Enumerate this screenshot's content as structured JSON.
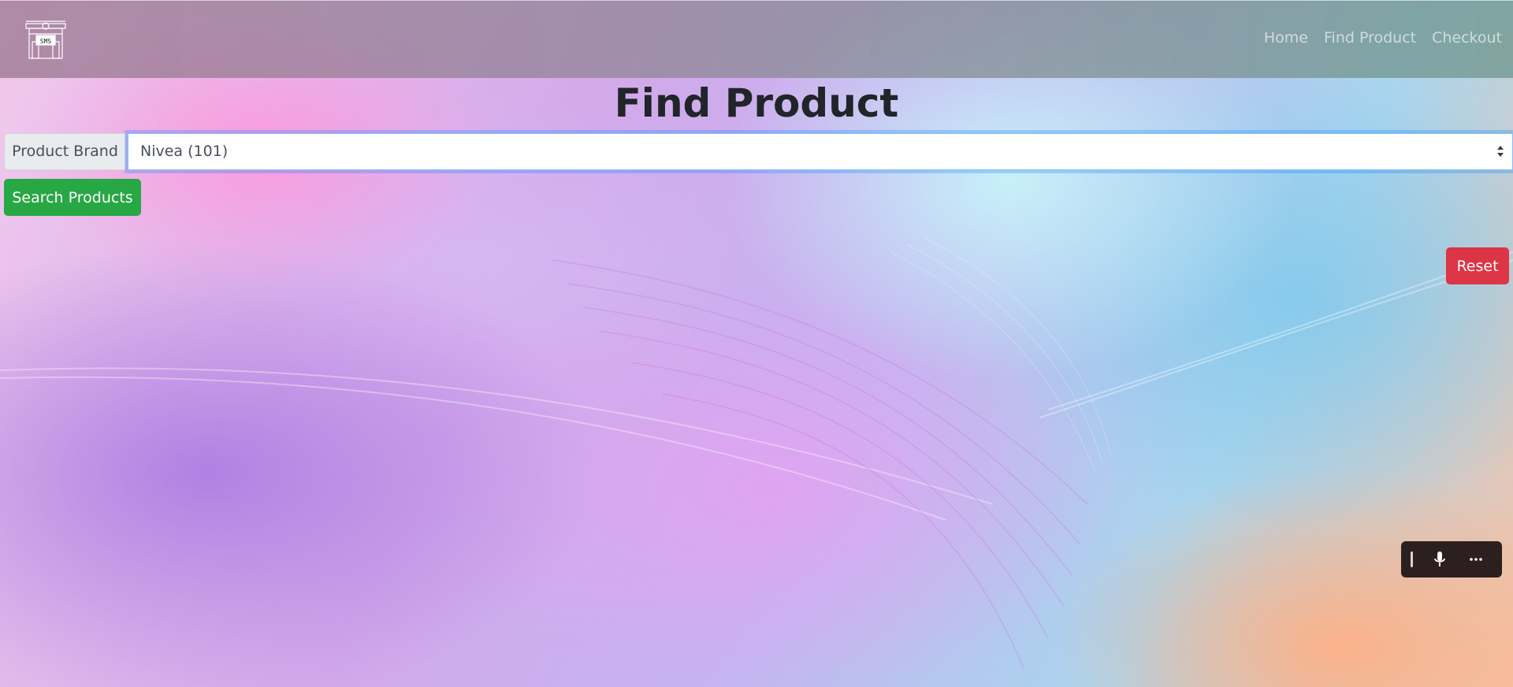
{
  "nav": {
    "logo_text": "SMS",
    "links": [
      "Home",
      "Find Product",
      "Checkout"
    ]
  },
  "page": {
    "title": "Find Product"
  },
  "form": {
    "brand_label": "Product Brand",
    "brand_selected": "Nivea (101)",
    "search_button": "Search Products",
    "reset_button": "Reset"
  },
  "toolbar": {
    "icons": [
      "drag-handle-icon",
      "microphone-icon",
      "more-options-icon"
    ]
  },
  "colors": {
    "search_button": "#28a745",
    "reset_button": "#dc3545",
    "toolbar_bg": "#2b201f"
  }
}
